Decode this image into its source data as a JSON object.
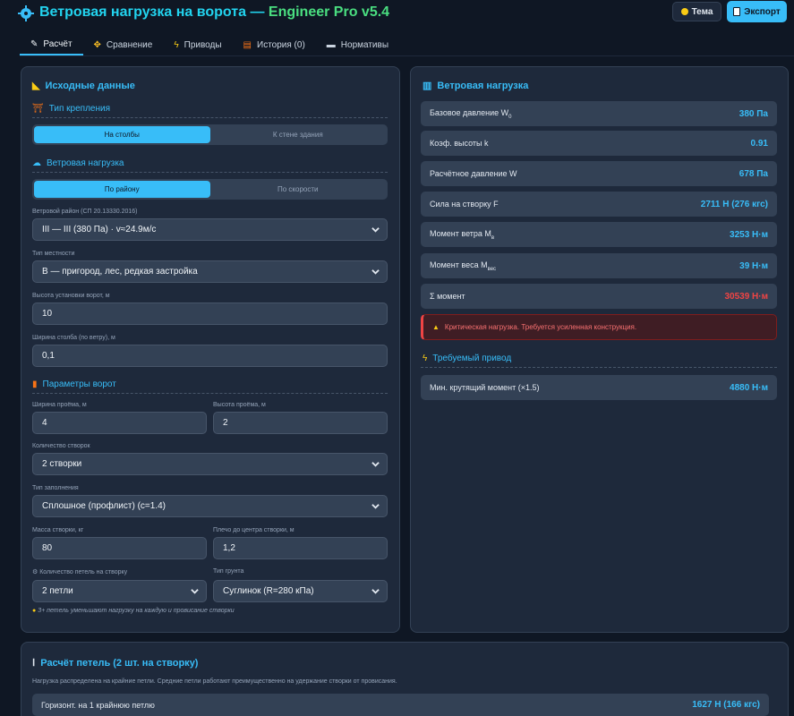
{
  "header": {
    "title": "Ветровая нагрузка на ворота — ",
    "version": "Engineer Pro v5.4",
    "theme_button": "Тема",
    "export_button": "Экспорт"
  },
  "tabs": [
    {
      "label": "Расчёт",
      "icon": "pencil-icon"
    },
    {
      "label": "Сравнение",
      "icon": "compare-icon"
    },
    {
      "label": "Приводы",
      "icon": "lightning-icon"
    },
    {
      "label": "История (0)",
      "icon": "books-icon"
    },
    {
      "label": "Нормативы",
      "icon": "document-icon"
    }
  ],
  "left": {
    "title": "Исходные данные",
    "mount": {
      "title": "Тип крепления",
      "options": [
        "На столбы",
        "К стене здания"
      ]
    },
    "wind": {
      "title": "Ветровая нагрузка",
      "options": [
        "По району",
        "По скорости"
      ],
      "region_label": "Ветровой район (СП 20.13330.2016)",
      "region_value": "III — III (380 Па) · v≈24.9м/с",
      "terrain_label": "Тип местности",
      "terrain_value": "B — пригород, лес, редкая застройка",
      "height_label": "Высота установки ворот, м",
      "height_value": "10",
      "post_width_label": "Ширина столба (по ветру), м",
      "post_width_value": "0,1"
    },
    "gate": {
      "title": "Параметры ворот",
      "opening_width_label": "Ширина проёма, м",
      "opening_width_value": "4",
      "opening_height_label": "Высота проёма, м",
      "opening_height_value": "2",
      "leaves_label": "Количество створок",
      "leaves_value": "2 створки",
      "fill_label": "Тип заполнения",
      "fill_value": "Сплошное (профлист) (c=1.4)",
      "mass_label": "Масса створки, кг",
      "mass_value": "80",
      "arm_label": "Плечо до центра створки, м",
      "arm_value": "1,2",
      "hinges_label": "Количество петель на створку",
      "hinges_value": "2 петли",
      "soil_label": "Тип грунта",
      "soil_value": "Суглинок (R=280 кПа)",
      "hint": "3+ петель уменьшают нагрузку на каждую и провисание створки"
    }
  },
  "right": {
    "title": "Ветровая нагрузка",
    "rows": [
      {
        "label": "Базовое давление W",
        "sub": "0",
        "value": "380 Па"
      },
      {
        "label": "Коэф. высоты k",
        "sub": "",
        "value": "0.91"
      },
      {
        "label": "Расчётное давление W",
        "sub": "",
        "value": "678 Па"
      },
      {
        "label": "Сила на створку F",
        "sub": "",
        "value": "2711 Н (276 кгс)"
      },
      {
        "label": "Момент ветра M",
        "sub": "в",
        "value": "3253 Н·м"
      },
      {
        "label": "Момент веса M",
        "sub": "вес",
        "value": "39 Н·м"
      },
      {
        "label": "Σ момент",
        "sub": "",
        "value": "30539 Н·м"
      }
    ],
    "warning": "Критическая нагрузка. Требуется усиленная конструкция.",
    "drive": {
      "title": "Требуемый привод",
      "label": "Мин. крутящий момент (×1.5)",
      "value": "4880 Н·м"
    }
  },
  "hinges": {
    "title": "Расчёт петель (2 шт. на створку)",
    "note": "Нагрузка распределена на крайние петли. Средние петли работают преимущественно на удержание створки от провисания.",
    "row_label": "Горизонт. на 1 крайнюю петлю",
    "row_value": "1627 Н (166 кгс)"
  },
  "colors": {
    "accent": "#38bdf8",
    "version": "#4ade80",
    "danger": "#ef4444",
    "background": "#0f1724",
    "panel": "#1e293b"
  }
}
